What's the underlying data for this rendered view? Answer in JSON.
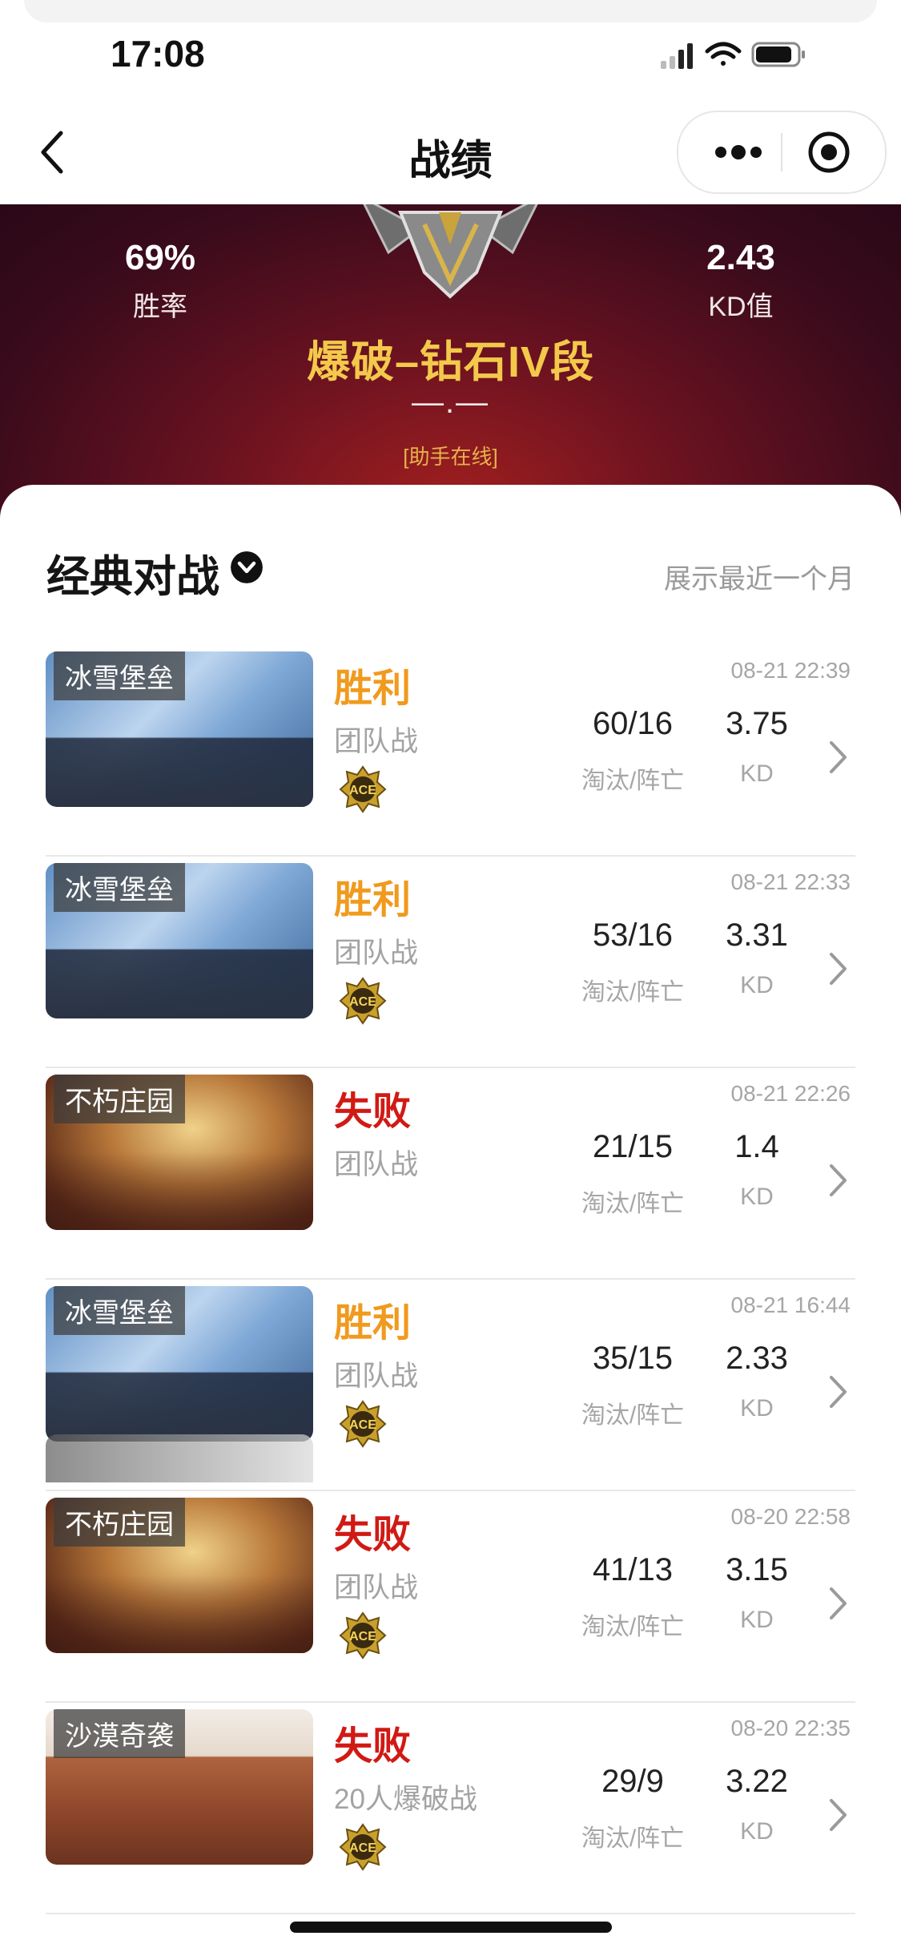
{
  "status_bar": {
    "time": "17:08"
  },
  "nav": {
    "title": "战绩"
  },
  "hero": {
    "win_rate": "69%",
    "win_rate_label": "胜率",
    "kd": "2.43",
    "kd_label": "KD值",
    "rank": "爆破–钻石IV段",
    "score": "—.—",
    "assistant": "[助手在线]"
  },
  "section": {
    "title": "经典对战",
    "note": "展示最近一个月"
  },
  "colors": {
    "win": "#f09a1e",
    "lose": "#d11a14",
    "rank_gold": "#f3c94b",
    "hero_bg": "#6a1220"
  },
  "matches": [
    {
      "map": "冰雪堡垒",
      "map_style": "snow",
      "result": "胜利",
      "outcome": "win",
      "mode": "团队战",
      "ace": true,
      "date": "08-21 22:39",
      "kills": "60/16",
      "kills_label": "淘汰/阵亡",
      "kd": "3.75",
      "kd_label": "KD"
    },
    {
      "map": "冰雪堡垒",
      "map_style": "snow",
      "result": "胜利",
      "outcome": "win",
      "mode": "团队战",
      "ace": true,
      "date": "08-21 22:33",
      "kills": "53/16",
      "kills_label": "淘汰/阵亡",
      "kd": "3.31",
      "kd_label": "KD"
    },
    {
      "map": "不朽庄园",
      "map_style": "manor",
      "result": "失败",
      "outcome": "lose",
      "mode": "团队战",
      "ace": false,
      "date": "08-21 22:26",
      "kills": "21/15",
      "kills_label": "淘汰/阵亡",
      "kd": "1.4",
      "kd_label": "KD"
    },
    {
      "map": "冰雪堡垒",
      "map_style": "snow",
      "result": "胜利",
      "outcome": "win",
      "mode": "团队战",
      "ace": true,
      "date": "08-21 16:44",
      "kills": "35/15",
      "kills_label": "淘汰/阵亡",
      "kd": "2.33",
      "kd_label": "KD"
    },
    {
      "map": "不朽庄园",
      "map_style": "manor",
      "result": "失败",
      "outcome": "lose",
      "mode": "团队战",
      "ace": true,
      "date": "08-20 22:58",
      "kills": "41/13",
      "kills_label": "淘汰/阵亡",
      "kd": "3.15",
      "kd_label": "KD"
    },
    {
      "map": "沙漠奇袭",
      "map_style": "desert",
      "result": "失败",
      "outcome": "lose",
      "mode": "20人爆破战",
      "ace": true,
      "date": "08-20 22:35",
      "kills": "29/9",
      "kills_label": "淘汰/阵亡",
      "kd": "3.22",
      "kd_label": "KD"
    }
  ],
  "icons": {
    "back": "chevron-left-icon",
    "more": "more-dots-icon",
    "close_target": "target-icon",
    "toggle": "chevron-down-circle-icon",
    "row_arrow": "chevron-right-icon",
    "ace": "ace-badge-icon"
  },
  "ace_text": "ACE"
}
